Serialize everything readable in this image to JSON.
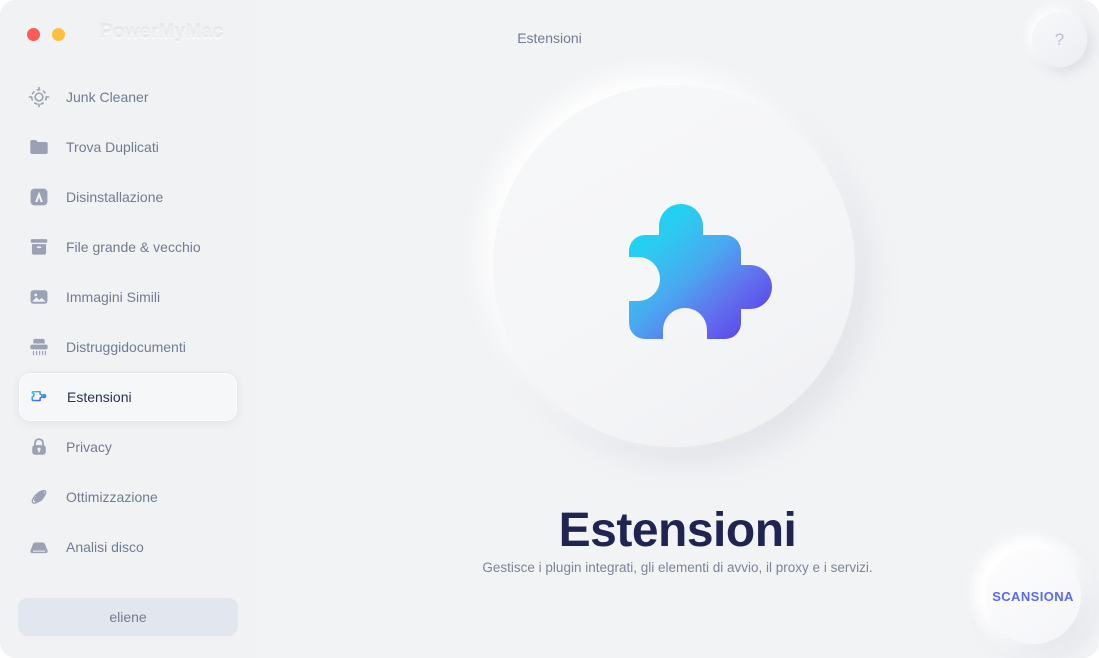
{
  "window": {
    "brand": "PowerMyMac",
    "traffic_lights": [
      {
        "name": "close",
        "color": "#fc5b57"
      },
      {
        "name": "minimize",
        "color": "#fcbf41"
      }
    ]
  },
  "header": {
    "title": "Estensioni",
    "help_label": "?"
  },
  "sidebar": {
    "items": [
      {
        "label": "Junk Cleaner",
        "icon": "target-gear-icon",
        "active": false
      },
      {
        "label": "Trova Duplicati",
        "icon": "folder-icon",
        "active": false
      },
      {
        "label": "Disinstallazione",
        "icon": "app-package-icon",
        "active": false
      },
      {
        "label": "File grande & vecchio",
        "icon": "archive-box-icon",
        "active": false
      },
      {
        "label": "Immagini Simili",
        "icon": "photo-icon",
        "active": false
      },
      {
        "label": "Distruggidocumenti",
        "icon": "shredder-icon",
        "active": false
      },
      {
        "label": "Estensioni",
        "icon": "puzzle-icon",
        "active": true
      },
      {
        "label": "Privacy",
        "icon": "lock-icon",
        "active": false
      },
      {
        "label": "Ottimizzazione",
        "icon": "rocket-orbit-icon",
        "active": false
      },
      {
        "label": "Analisi disco",
        "icon": "hard-drive-icon",
        "active": false
      }
    ],
    "action_button": "eliene"
  },
  "main": {
    "hero_icon": "puzzle-piece-icon",
    "title": "Estensioni",
    "subtitle": "Gestisce i plugin integrati, gli elementi di avvio, il proxy e i servizi.",
    "scan_button": "SCANSIONA"
  },
  "colors": {
    "background": "#f2f3f5",
    "sidebar": "#f1f2f4",
    "text_muted": "#737b91",
    "text_dark": "#1f2450",
    "accent_blue": "#5b6bf0",
    "gradient_start": "#22d3ee",
    "gradient_end": "#5b4ae8"
  }
}
